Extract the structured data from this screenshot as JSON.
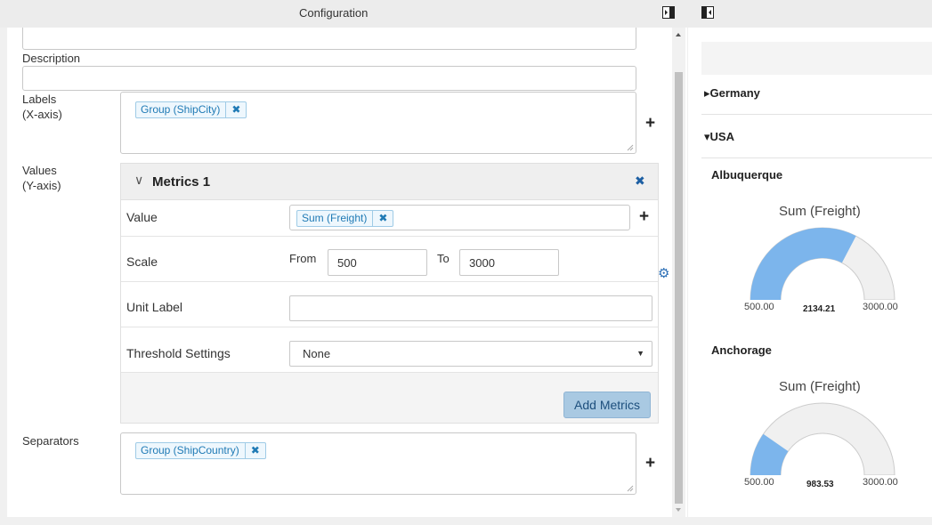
{
  "header": {
    "title": "Configuration",
    "icons": [
      "collapse-right-icon",
      "collapse-left-icon"
    ]
  },
  "form": {
    "description_label": "Description",
    "labels_label": "Labels\n(X-axis)",
    "labels_chip": "Group (ShipCity)",
    "values_label": "Values\n(Y-axis)",
    "separators_label": "Separators",
    "separators_chip": "Group (ShipCountry)",
    "chip_remove_glyph": "✖",
    "plus_glyph": "+"
  },
  "metrics": {
    "chevron_glyph": "∨",
    "title": "Metrics 1",
    "close_glyph": "✖",
    "value_label": "Value",
    "value_chip": "Sum (Freight)",
    "scale_label": "Scale",
    "from_label": "From",
    "from_value": "500",
    "to_label": "To",
    "to_value": "3000",
    "unit_label": "Unit Label",
    "unit_value": "",
    "threshold_label": "Threshold Settings",
    "threshold_selected": "None",
    "add_button": "Add Metrics",
    "gear_glyph": "⚙"
  },
  "preview": {
    "groups": [
      {
        "name": "Germany",
        "expanded": false,
        "arrow": "▸"
      },
      {
        "name": "USA",
        "expanded": true,
        "arrow": "▾"
      }
    ],
    "gauges": [
      {
        "city": "Albuquerque",
        "title": "Sum (Freight)",
        "min_label": "500.00",
        "max_label": "3000.00",
        "value_label": "2134.21",
        "min": 500,
        "max": 3000,
        "value": 2134.21
      },
      {
        "city": "Anchorage",
        "title": "Sum (Freight)",
        "min_label": "500.00",
        "max_label": "3000.00",
        "value_label": "983.53",
        "min": 500,
        "max": 3000,
        "value": 983.53
      }
    ],
    "colors": {
      "fill": "#7cb5ec",
      "track": "#f0f0f0",
      "track_border": "#cccccc"
    }
  }
}
